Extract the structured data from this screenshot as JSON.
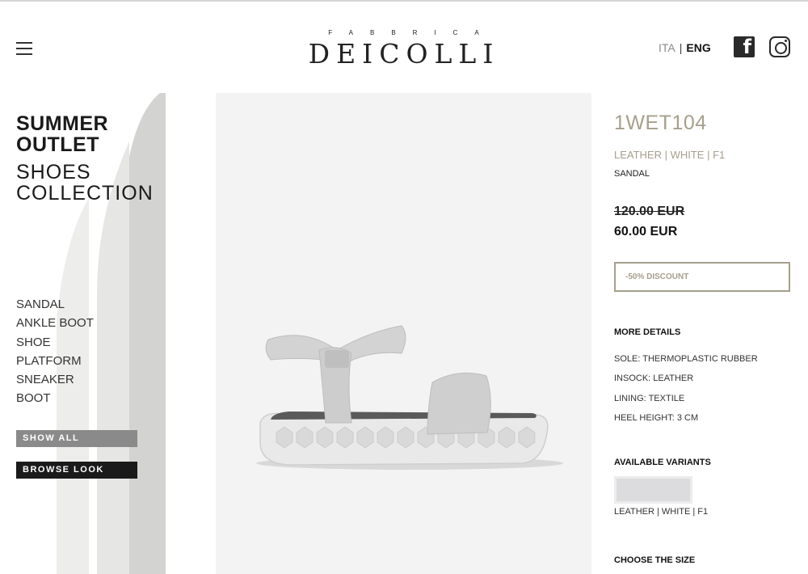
{
  "colors": {
    "accent": "#a59f8b",
    "dark": "#1a1a1a",
    "button_grey": "#8a8a8a",
    "image_bg": "#f3f3f3"
  },
  "header": {
    "logo_top": "FABBRICA",
    "logo_main": "DEICOLLI",
    "lang_ita": "ITA",
    "lang_sep": "|",
    "lang_eng": "ENG",
    "icons": [
      "hamburger-menu-icon",
      "facebook-icon",
      "instagram-icon"
    ]
  },
  "sidebar": {
    "title_bold_1": "SUMMER",
    "title_bold_2": "OUTLET",
    "title_light_1": "SHOES",
    "title_light_2": "COLLECTION",
    "categories": [
      "SANDAL",
      "ANKLE BOOT",
      "SHOE",
      "PLATFORM",
      "SNEAKER",
      "BOOT"
    ],
    "show_all": "SHOW ALL",
    "browse_look": "BROWSE LOOK"
  },
  "product": {
    "code": "1WET104",
    "variant": "LEATHER | WHITE | F1",
    "type": "SANDAL",
    "old_price": "120.00 EUR",
    "new_price": "60.00 EUR",
    "discount": "-50% DISCOUNT",
    "details_title": "MORE DETAILS",
    "details": [
      "SOLE: THERMOPLASTIC RUBBER",
      "INSOCK: LEATHER",
      "LINING: TEXTILE",
      "HEEL HEIGHT: 3 CM"
    ],
    "variants_title": "AVAILABLE VARIANTS",
    "variant_option": "LEATHER | WHITE | F1",
    "size_title": "CHOOSE THE SIZE"
  }
}
